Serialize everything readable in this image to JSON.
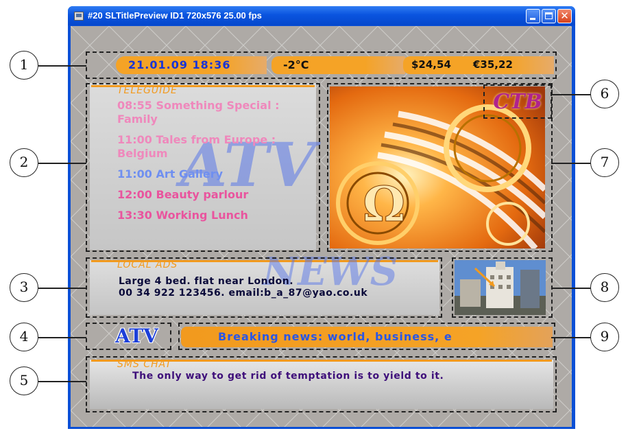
{
  "window": {
    "title": "#20 SLTitlePreview ID1 720x576 25.00 fps"
  },
  "info_bar": {
    "datetime": "21.01.09 18:36",
    "temperature": "-2°C",
    "usd_rate": "$24,54",
    "eur_rate": "€35,22"
  },
  "teleguide": {
    "header": "TELEGUIDE",
    "items": [
      {
        "text": "08:55 Something Special :",
        "color": "#ef88bc"
      },
      {
        "text": "Family",
        "color": "#ef88bc"
      },
      {
        "text": "11:00 Tales from Europe :",
        "color": "#ef88bc"
      },
      {
        "text": "Belgium",
        "color": "#ef88bc"
      },
      {
        "text": "11:00 Art Gallery",
        "color": "#6f8ff0"
      },
      {
        "text": "12:00 Beauty parlour",
        "color": "#e9549e"
      },
      {
        "text": "13:30 Working Lunch",
        "color": "#e9549e"
      }
    ]
  },
  "logo": {
    "text": "CTB",
    "color": "#b0238e"
  },
  "local_ads": {
    "header": "LOCAL ADS",
    "line1": "Large 4 bed. flat near London.",
    "line2": "00 34 922 123456. email:b_a_87@yao.co.uk"
  },
  "channel_logo": {
    "text": "ATV",
    "color": "#1c3fd8"
  },
  "news_ticker": {
    "text": "Breaking news: world, business, e"
  },
  "sms_chat": {
    "header": "SMS CHAT",
    "message": "The only way to get rid of temptation is to yield to it."
  },
  "callouts": [
    "1",
    "2",
    "3",
    "4",
    "5",
    "6",
    "7",
    "8",
    "9"
  ],
  "colors": {
    "accent": "#f5a326",
    "titlebar": "#0a54df",
    "preview_bg": "#aeaaa6",
    "ad_text": "#0a0a3a",
    "chat_text": "#3e0f7a"
  }
}
